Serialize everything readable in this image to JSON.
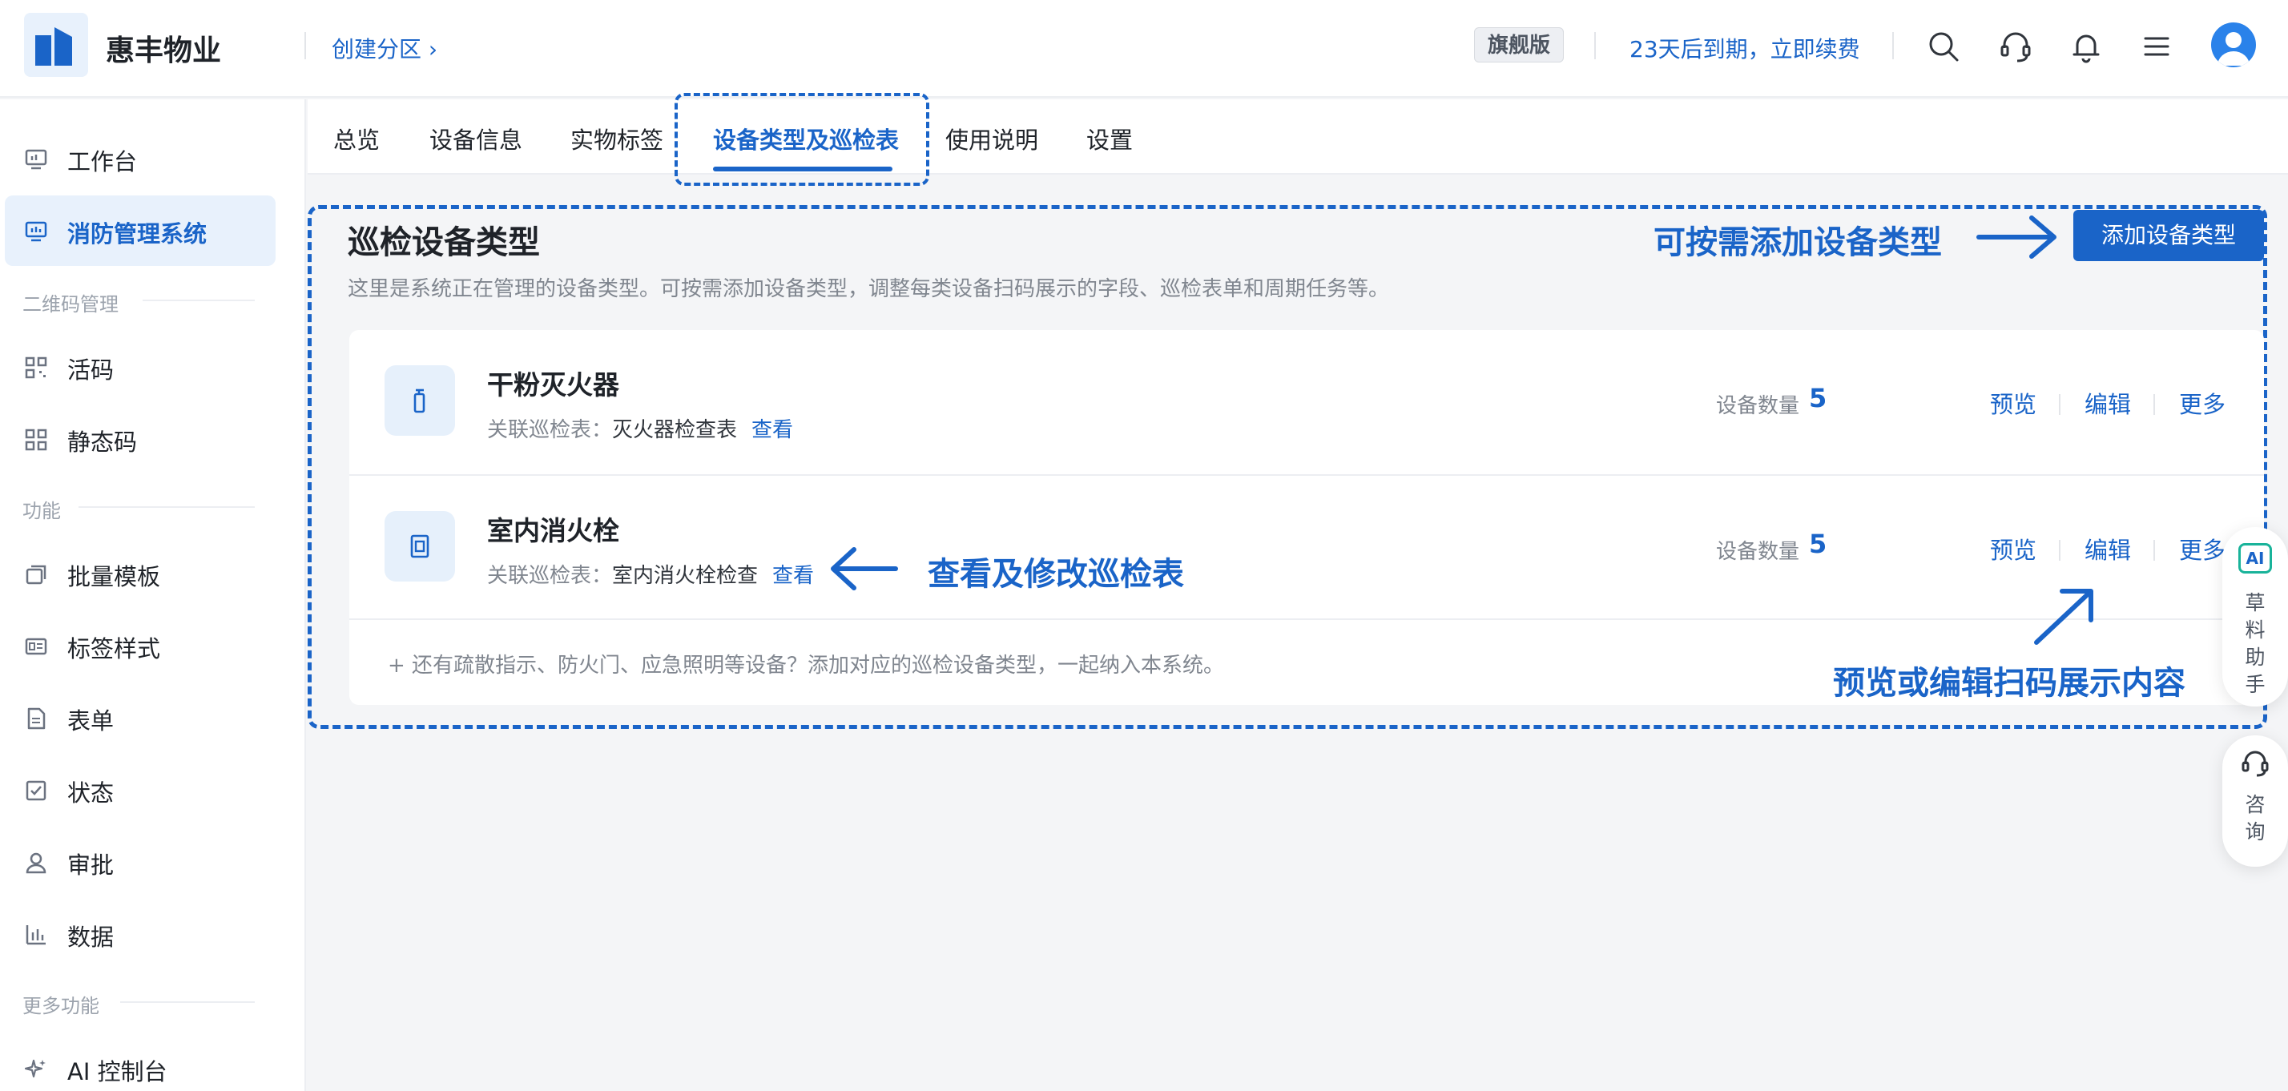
{
  "header": {
    "brand": "惠丰物业",
    "breadcrumb": "创建分区 ›",
    "plan_badge": "旗舰版",
    "expire_notice": "23天后到期，立即续费"
  },
  "sidebar": {
    "items_top": [
      {
        "label": "工作台",
        "icon": "workbench-icon"
      },
      {
        "label": "消防管理系统",
        "icon": "monitor-icon",
        "active": true
      }
    ],
    "group_qrcode": "二维码管理",
    "items_qrcode": [
      {
        "label": "活码",
        "icon": "qrcode-icon"
      },
      {
        "label": "静态码",
        "icon": "static-qrcode-icon"
      }
    ],
    "group_function": "功能",
    "items_function": [
      {
        "label": "批量模板",
        "icon": "template-icon"
      },
      {
        "label": "标签样式",
        "icon": "label-style-icon"
      },
      {
        "label": "表单",
        "icon": "form-icon"
      },
      {
        "label": "状态",
        "icon": "status-icon"
      },
      {
        "label": "审批",
        "icon": "approval-icon"
      },
      {
        "label": "数据",
        "icon": "data-icon"
      }
    ],
    "group_more": "更多功能",
    "items_more": [
      {
        "label": "AI 控制台",
        "icon": "ai-sparkle-icon"
      }
    ]
  },
  "tabs": [
    "总览",
    "设备信息",
    "实物标签",
    "设备类型及巡检表",
    "使用说明",
    "设置"
  ],
  "active_tab": "设备类型及巡检表",
  "main": {
    "title": "巡检设备类型",
    "description": "这里是系统正在管理的设备类型。可按需添加设备类型，调整每类设备扫码展示的字段、巡检表单和周期任务等。",
    "add_button": "添加设备类型",
    "rows": [
      {
        "name": "干粉灭火器",
        "link_label": "关联巡检表：",
        "link_value": "灭火器检查表",
        "view": "查看",
        "count_label": "设备数量",
        "count": "5",
        "actions": [
          "预览",
          "编辑",
          "更多"
        ]
      },
      {
        "name": "室内消火栓",
        "link_label": "关联巡检表：",
        "link_value": "室内消火栓检查",
        "view": "查看",
        "count_label": "设备数量",
        "count": "5",
        "actions": [
          "预览",
          "编辑",
          "更多"
        ]
      }
    ],
    "footer_tip": "+ 还有疏散指示、防火门、应急照明等设备？添加对应的巡检设备类型，一起纳入本系统。"
  },
  "annotations": {
    "add_type": "可按需添加设备类型",
    "view_edit": "查看及修改巡检表",
    "preview_edit": "预览或编辑扫码展示内容"
  },
  "float_panel": {
    "ai_badge": "AI",
    "ai_label": [
      "草",
      "料",
      "助",
      "手"
    ],
    "consult_label": [
      "咨",
      "询"
    ]
  },
  "colors": {
    "accent": "#1a64c8",
    "active_bg": "#e8f1fc"
  }
}
